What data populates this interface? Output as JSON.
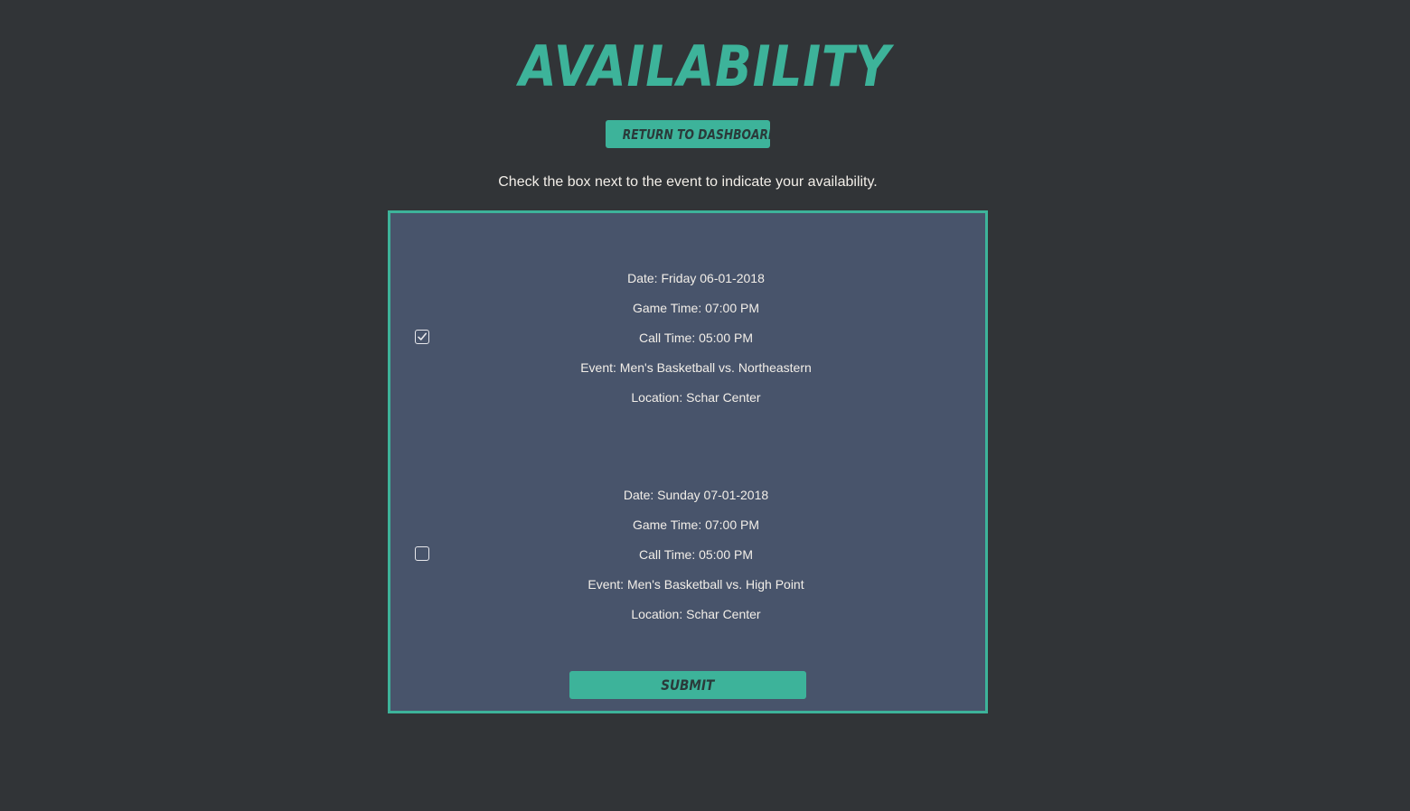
{
  "page": {
    "title": "AVAILABILITY",
    "dashboard_button": "RETURN TO DASHBOARD",
    "instruction": "Check the box next to the event to indicate your availability."
  },
  "events": [
    {
      "checked": true,
      "date": "Date: Friday 06-01-2018",
      "game_time": "Game Time: 07:00 PM",
      "call_time": "Call Time: 05:00 PM",
      "event": "Event: Men's Basketball vs. Northeastern",
      "location": "Location: Schar Center"
    },
    {
      "checked": false,
      "date": "Date: Sunday 07-01-2018",
      "game_time": "Game Time: 07:00 PM",
      "call_time": "Call Time: 05:00 PM",
      "event": "Event: Men's Basketball vs. High Point",
      "location": "Location: Schar Center"
    }
  ],
  "form": {
    "submit_label": "SUBMIT"
  },
  "colors": {
    "background": "#313437",
    "accent": "#3db39a",
    "panel": "#48546b",
    "text": "#f2eee8"
  },
  "icons": {
    "checked": "checkmark-icon"
  }
}
